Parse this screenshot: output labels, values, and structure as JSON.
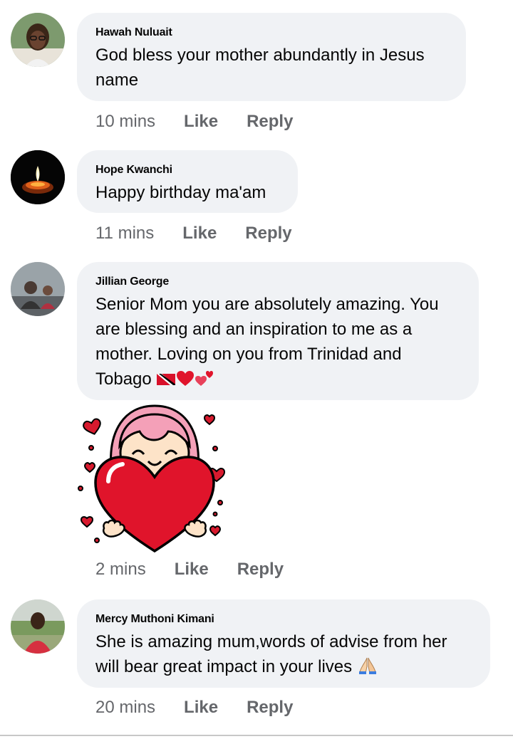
{
  "comments": [
    {
      "author": "Hawah Nuluait",
      "text_line1": "God bless your mother abundantly in Jesus",
      "text_line2": "name",
      "time": "10 mins",
      "like": "Like",
      "reply": "Reply"
    },
    {
      "author": "Hope Kwanchi",
      "text_line1": "Happy birthday ma'am",
      "time": "11 mins",
      "like": "Like",
      "reply": "Reply"
    },
    {
      "author": "Jillian George",
      "text_line1": "Senior Mom you are absolutely amazing. You",
      "text_line2": "are blessing and an inspiration to me as a",
      "text_line3": "mother.  Loving on you from Trinidad and",
      "text_line4": "Tobago",
      "time": "2 mins",
      "like": "Like",
      "reply": "Reply",
      "emojis": [
        "trinidad-tobago-flag",
        "red-heart",
        "two-hearts"
      ],
      "sticker": "girl-hugging-heart-sticker"
    },
    {
      "author": "Mercy Muthoni Kimani",
      "text_line1": "She is amazing mum,words of advise from her",
      "text_line2": "will bear great impact in your lives",
      "time": "20 mins",
      "like": "Like",
      "reply": "Reply",
      "emojis": [
        "folded-hands"
      ]
    }
  ],
  "colors": {
    "bubble": "#f0f2f5",
    "meta_text": "#65676b",
    "heart": "#e0142b",
    "hair": "#f4a0b8"
  }
}
